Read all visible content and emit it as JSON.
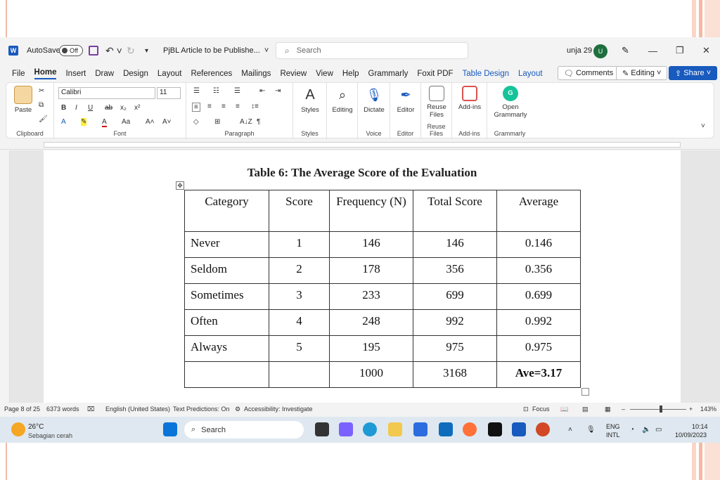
{
  "titlebar": {
    "autosave_label": "AutoSave",
    "toggle_state": "Off",
    "doc_title": "PjBL Article to be Publishe...",
    "search_placeholder": "Search",
    "user_name": "unja 29",
    "user_initial": "U"
  },
  "tabs": [
    "File",
    "Home",
    "Insert",
    "Draw",
    "Design",
    "Layout",
    "References",
    "Mailings",
    "Review",
    "View",
    "Help",
    "Grammarly",
    "Foxit PDF",
    "Table Design",
    "Layout"
  ],
  "active_tab": "Home",
  "ribbon_buttons": {
    "comments": "Comments",
    "editing": "Editing",
    "share": "Share"
  },
  "ribbon": {
    "paste": "Paste",
    "clipboard": "Clipboard",
    "font_name": "Calibri",
    "font_size": "11",
    "font": "Font",
    "paragraph": "Paragraph",
    "styles_btn": "Styles",
    "styles": "Styles",
    "editing_btn": "Editing",
    "dictate": "Dictate",
    "voice": "Voice",
    "editor_btn": "Editor",
    "editor": "Editor",
    "reuse_files": "Reuse Files",
    "reuse_files_group": "Reuse Files",
    "addins_btn": "Add-ins",
    "addins": "Add-ins",
    "open_grammarly": "Open Grammarly",
    "grammarly": "Grammarly"
  },
  "document": {
    "table_title": "Table 6: The Average Score of the Evaluation",
    "headers": [
      "Category",
      "Score",
      "Frequency (N)",
      "Total Score",
      "Average"
    ],
    "rows": [
      [
        "Never",
        "1",
        "146",
        "146",
        "0.146"
      ],
      [
        "Seldom",
        "2",
        "178",
        "356",
        "0.356"
      ],
      [
        "Sometimes",
        "3",
        "233",
        "699",
        "0.699"
      ],
      [
        "Often",
        "4",
        "248",
        "992",
        "0.992"
      ],
      [
        "Always",
        "5",
        "195",
        "975",
        "0.975"
      ]
    ],
    "totals": [
      "",
      "",
      "1000",
      "3168",
      "Ave=3.17"
    ]
  },
  "statusbar": {
    "page": "Page 8 of 25",
    "words": "6373 words",
    "language": "English (United States)",
    "predictions": "Text Predictions: On",
    "accessibility": "Accessibility: Investigate",
    "focus": "Focus",
    "zoom": "143%"
  },
  "taskbar": {
    "temperature": "26°C",
    "weather": "Sebagian cerah",
    "search": "Search",
    "lang1": "ENG",
    "lang2": "INTL",
    "time": "10:14",
    "date": "10/09/2023"
  },
  "colors": {
    "word_blue": "#185abd",
    "share_blue": "#185abd",
    "taskbar_bg": "#dfe8f0"
  }
}
